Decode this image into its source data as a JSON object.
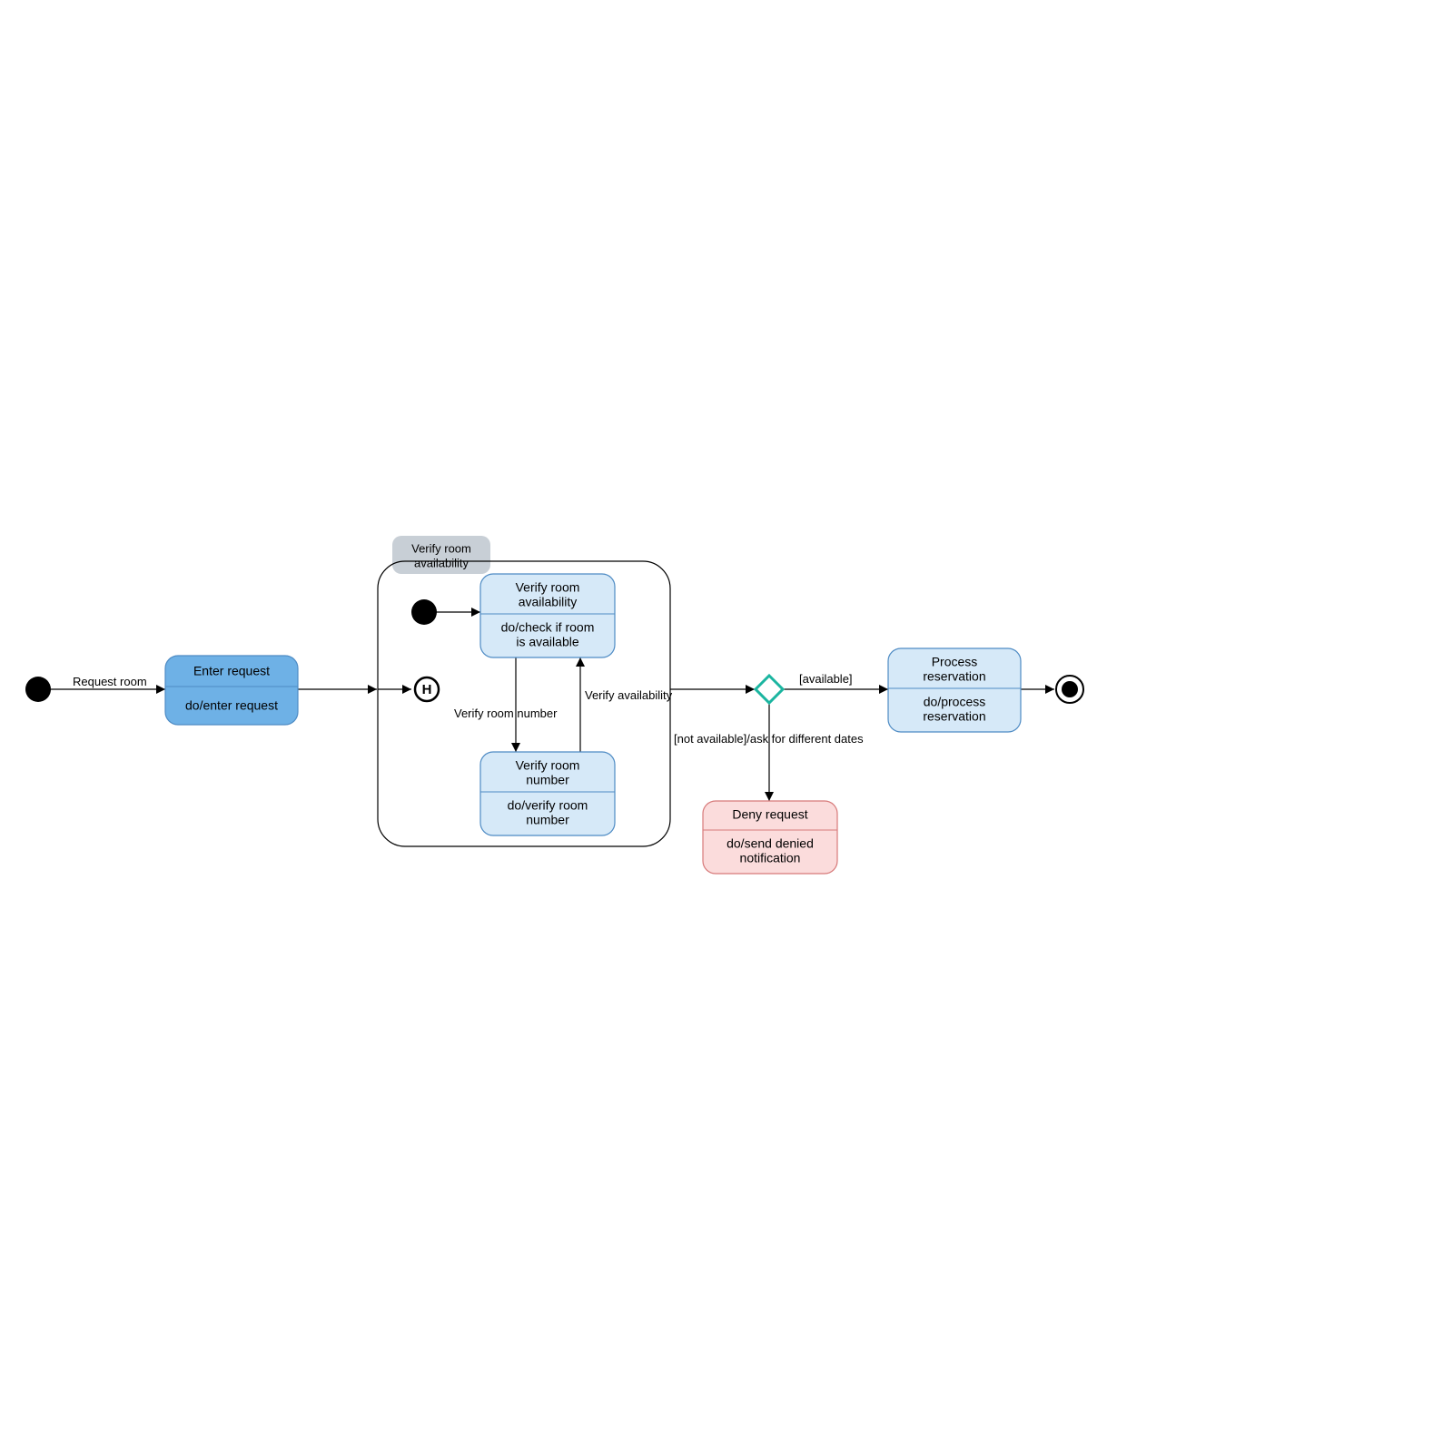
{
  "diagram": {
    "type": "uml-state",
    "labels": {
      "request_room": "Request room",
      "available": "[available]",
      "not_available": "[not available]/ask for different dates",
      "verify_room_number_edge": "Verify room number",
      "verify_availability_edge": "Verify availability",
      "composite_title": "Verify room\navailability",
      "history": "H"
    },
    "states": {
      "enter_request": {
        "title": "Enter request",
        "body": "do/enter request"
      },
      "verify_room_availability": {
        "title": "Verify room\navailability",
        "body": "do/check if room\nis available"
      },
      "verify_room_number": {
        "title": "Verify room\nnumber",
        "body": "do/verify room\nnumber"
      },
      "process_reservation": {
        "title": "Process\nreservation",
        "body": "do/process\nreservation"
      },
      "deny_request": {
        "title": "Deny request",
        "body": "do/send denied\nnotification"
      }
    }
  }
}
